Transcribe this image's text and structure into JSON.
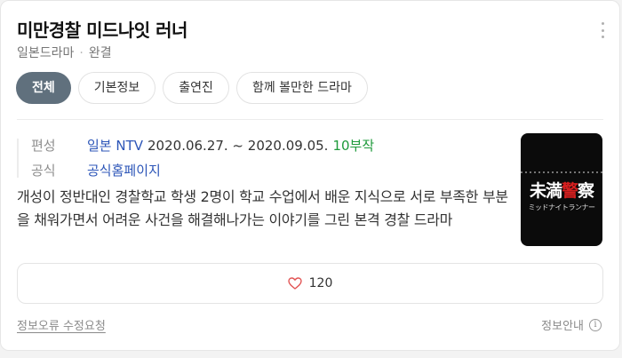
{
  "header": {
    "title": "미만경찰 미드나잇 러너",
    "genre": "일본드라마",
    "status": "완결",
    "separator": "·"
  },
  "tabs": [
    {
      "label": "전체",
      "active": true
    },
    {
      "label": "기본정보",
      "active": false
    },
    {
      "label": "출연진",
      "active": false
    },
    {
      "label": "함께 볼만한 드라마",
      "active": false
    }
  ],
  "info": {
    "broadcast_label": "편성",
    "channel": "일본 NTV",
    "period": "2020.06.27. ~ 2020.09.05.",
    "episodes": "10부작",
    "official_label": "공식",
    "official_link": "공식홈페이지"
  },
  "description": "개성이 정반대인 경찰학교 학생 2명이 학교 수업에서 배운 지식으로 서로 부족한 부분을 채워가면서 어려운 사건을 해결해나가는 이야기를 그린 본격 경찰 드라마",
  "poster": {
    "logo_part1": "未満",
    "logo_part2": "警",
    "logo_part3": "察",
    "subtitle": "ミッドナイトランナー"
  },
  "like": {
    "count": "120",
    "icon": "heart-outline-icon",
    "color": "#e25555"
  },
  "footer": {
    "error_report": "정보오류 수정요청",
    "info_guide": "정보안내",
    "info_icon": "i"
  }
}
